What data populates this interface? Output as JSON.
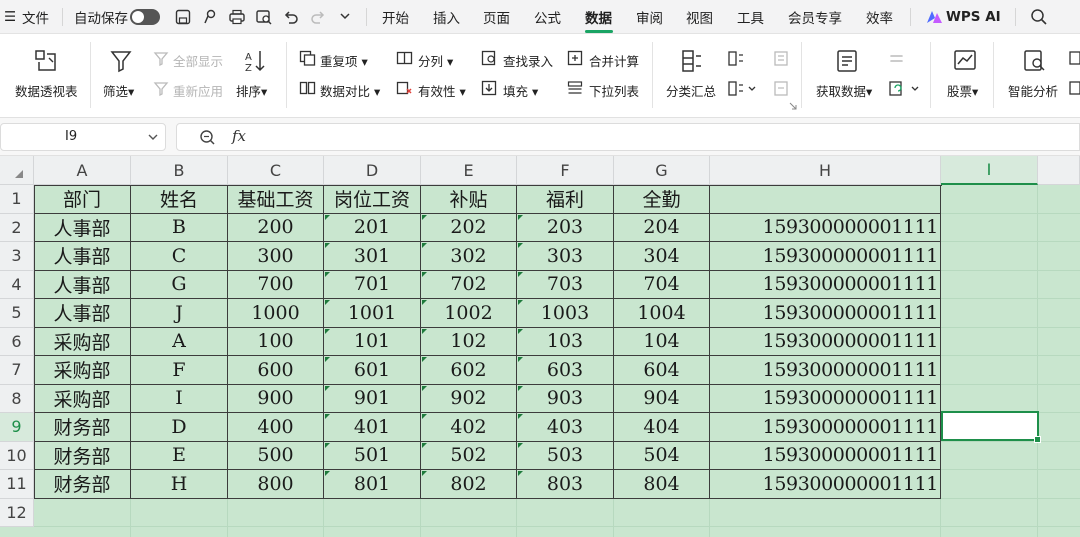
{
  "menubar": {
    "hamburger": "☰",
    "file": "文件",
    "autosave": "自动保存",
    "tabs": [
      "开始",
      "插入",
      "页面",
      "公式",
      "数据",
      "审阅",
      "视图",
      "工具",
      "会员专享",
      "效率"
    ],
    "active_tab": "数据",
    "wps_ai": "WPS AI"
  },
  "ribbon": {
    "pivot": "数据透视表",
    "filter": "筛选",
    "show_all": "全部显示",
    "reapply": "重新应用",
    "sort": "排序",
    "duplicates": "重复项",
    "compare": "数据对比",
    "split": "分列",
    "validity": "有效性",
    "lookup_entry": "查找录入",
    "fill": "填充",
    "merge_calc": "合并计算",
    "dropdown_list": "下拉列表",
    "subtotal": "分类汇总",
    "get_data": "获取数据",
    "stocks": "股票",
    "smart_analysis": "智能分析"
  },
  "formula_bar": {
    "name_box": "I9",
    "fx": "fx",
    "formula": ""
  },
  "sheet": {
    "columns": [
      "A",
      "B",
      "C",
      "D",
      "E",
      "F",
      "G",
      "H",
      "I"
    ],
    "selected_column": "I",
    "rows": [
      "1",
      "2",
      "3",
      "4",
      "5",
      "6",
      "7",
      "8",
      "9",
      "10",
      "11",
      "12"
    ],
    "selected_row": "9",
    "headers": [
      "部门",
      "姓名",
      "基础工资",
      "岗位工资",
      "补贴",
      "福利",
      "全勤",
      ""
    ],
    "data": [
      [
        "人事部",
        "B",
        "200",
        "201",
        "202",
        "203",
        "204",
        "159300000001111"
      ],
      [
        "人事部",
        "C",
        "300",
        "301",
        "302",
        "303",
        "304",
        "159300000001111"
      ],
      [
        "人事部",
        "G",
        "700",
        "701",
        "702",
        "703",
        "704",
        "159300000001111"
      ],
      [
        "人事部",
        "J",
        "1000",
        "1001",
        "1002",
        "1003",
        "1004",
        "159300000001111"
      ],
      [
        "采购部",
        "A",
        "100",
        "101",
        "102",
        "103",
        "104",
        "159300000001111"
      ],
      [
        "采购部",
        "F",
        "600",
        "601",
        "602",
        "603",
        "604",
        "159300000001111"
      ],
      [
        "采购部",
        "I",
        "900",
        "901",
        "902",
        "903",
        "904",
        "159300000001111"
      ],
      [
        "财务部",
        "D",
        "400",
        "401",
        "402",
        "403",
        "404",
        "159300000001111"
      ],
      [
        "财务部",
        "E",
        "500",
        "501",
        "502",
        "503",
        "504",
        "159300000001111"
      ],
      [
        "财务部",
        "H",
        "800",
        "801",
        "802",
        "803",
        "804",
        "159300000001111"
      ]
    ]
  },
  "colors": {
    "accent": "#1aa464",
    "sheet_fill": "#c9e6cf",
    "selection": "#1e8f4a"
  }
}
